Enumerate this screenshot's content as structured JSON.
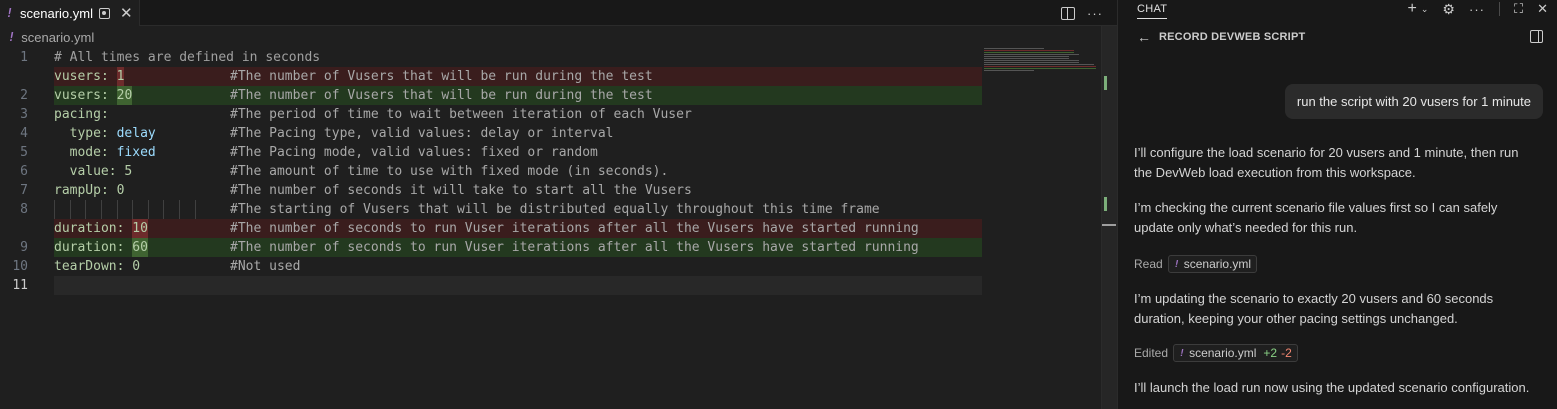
{
  "editor": {
    "tab": {
      "icon": "!",
      "name": "scenario.yml",
      "close": "✕"
    },
    "breadcrumb": {
      "icon": "!",
      "file": "scenario.yml"
    },
    "lines": [
      {
        "num": "1",
        "kind": "normal",
        "comment_line": "# All times are defined in seconds"
      },
      {
        "num": "",
        "kind": "del",
        "key": "vusers:",
        "val": "1",
        "comment": "#The number of Vusers that will be run during the test"
      },
      {
        "num": "2",
        "kind": "add",
        "key": "vusers:",
        "val": "20",
        "comment": "#The number of Vusers that will be run during the test"
      },
      {
        "num": "3",
        "kind": "normal",
        "key": "pacing:",
        "val": "",
        "comment": "#The period of time to wait between iteration of each Vuser"
      },
      {
        "num": "4",
        "kind": "normal",
        "indent": "  ",
        "key": "type:",
        "val": "delay",
        "comment": "#The Pacing type, valid values: delay or interval"
      },
      {
        "num": "5",
        "kind": "normal",
        "indent": "  ",
        "key": "mode:",
        "val": "fixed",
        "comment": "#The Pacing mode, valid values: fixed or random"
      },
      {
        "num": "6",
        "kind": "normal",
        "indent": "  ",
        "key": "value:",
        "val": "5",
        "comment": "#The amount of time to use with fixed mode (in seconds)."
      },
      {
        "num": "7",
        "kind": "normal",
        "key": "rampUp:",
        "val": "0",
        "comment": "#The number of seconds it will take to start all the Vusers"
      },
      {
        "num": "8",
        "kind": "normal",
        "key": "",
        "val": "",
        "comment": "#The starting of Vusers that will be distributed equally throughout this time frame"
      },
      {
        "num": "",
        "kind": "del",
        "key": "duration:",
        "val": "10",
        "comment": "#The number of seconds to run Vuser iterations after all the Vusers have started running"
      },
      {
        "num": "9",
        "kind": "add",
        "key": "duration:",
        "val": "60",
        "comment": "#The number of seconds to run Vuser iterations after all the Vusers have started running"
      },
      {
        "num": "10",
        "kind": "normal",
        "key": "tearDown:",
        "val": "0",
        "comment": "#Not used"
      },
      {
        "num": "11",
        "kind": "active",
        "key": "",
        "val": "",
        "comment": ""
      }
    ]
  },
  "chat": {
    "title": "CHAT",
    "subtitle": "RECORD DEVWEB SCRIPT",
    "user_message": "run the script with 20 vusers for 1 minute",
    "p1": "I’ll configure the load scenario for 20 vusers and 1 minute, then run the DevWeb load execution from this workspace.",
    "p2": "I’m checking the current scenario file values first so I can safely update only what’s needed for this run.",
    "read_label": "Read",
    "read_file": "scenario.yml",
    "p3": "I’m updating the scenario to exactly 20 vusers and 60 seconds duration, keeping your other pacing settings unchanged.",
    "edited_label": "Edited",
    "edited_file": "scenario.yml",
    "added": "+2",
    "removed": "-2",
    "p4": "I’ll launch the load run now using the updated scenario configuration.",
    "file_icon": "!"
  }
}
